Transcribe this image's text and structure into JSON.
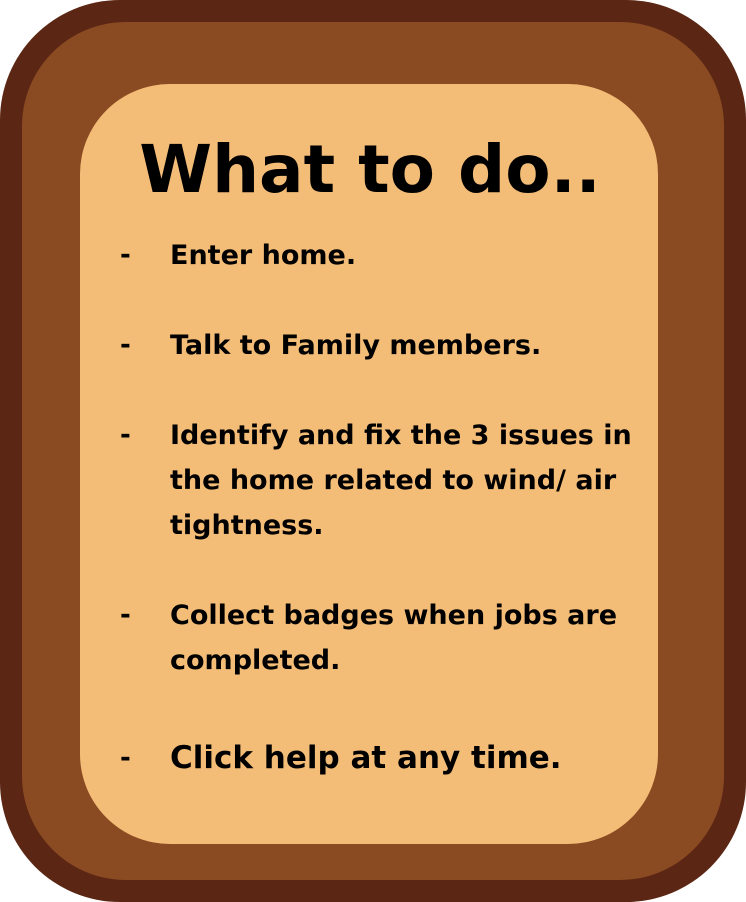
{
  "title": "What to do..",
  "bullet": "-",
  "items": [
    {
      "lines": [
        "Enter home."
      ]
    },
    {
      "lines": [
        "Talk to Family members."
      ]
    },
    {
      "lines": [
        "Identify and fix the 3 issues in",
        "the home related to wind/ air",
        "tightness."
      ]
    },
    {
      "lines": [
        "Collect badges when jobs are",
        "completed."
      ]
    },
    {
      "lines": [
        "Click help at any time."
      ]
    }
  ],
  "colors": {
    "outer_frame": "#5b2613",
    "inner_frame": "#8a4a22",
    "panel": "#f4bd77",
    "text": "#000000"
  }
}
